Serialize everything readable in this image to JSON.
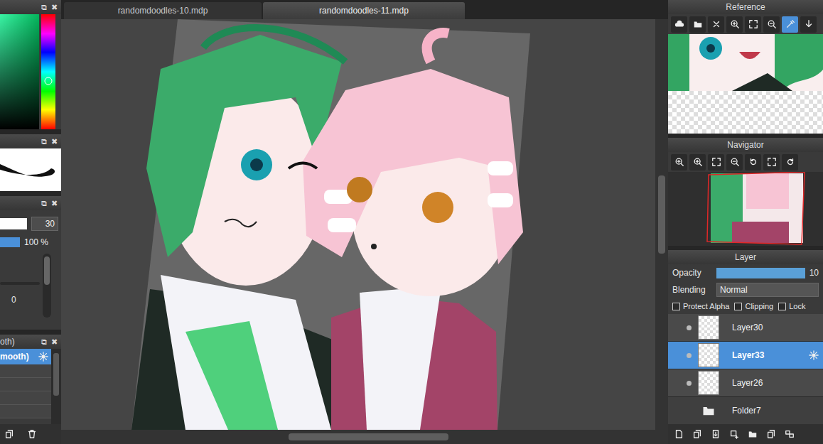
{
  "tabs": [
    {
      "label": "randomdoodles-10.mdp",
      "selected": false
    },
    {
      "label": "randomdoodles-11.mdp",
      "selected": true
    }
  ],
  "panel_buttons": {
    "float": "⧉",
    "close": "✖"
  },
  "color_panel": {
    "hue_level": 0.58
  },
  "brush_settings": {
    "size": "30",
    "opacity_reading": "100 %",
    "opacity_level": 1,
    "spacing_reading": "0"
  },
  "brush_list": {
    "header": "oth)",
    "items": [
      {
        "label": "mooth)",
        "selected": true
      }
    ]
  },
  "reference": {
    "title": "Reference",
    "tools": [
      {
        "selected": false
      },
      {
        "selected": false
      },
      {
        "selected": false
      },
      {
        "selected": false
      },
      {
        "selected": false
      },
      {
        "selected": false
      },
      {
        "selected": true
      },
      {
        "selected": false
      }
    ]
  },
  "navigator": {
    "title": "Navigator"
  },
  "layer": {
    "title": "Layer",
    "opacity_label": "Opacity",
    "opacity_reading": "10",
    "opacity_level": 1,
    "blending_label": "Blending",
    "blending": "Normal",
    "options": [
      {
        "label": "Protect Alpha",
        "checked": false
      },
      {
        "label": "Clipping",
        "checked": false
      },
      {
        "label": "Lock",
        "checked": false
      }
    ],
    "layers": [
      {
        "name": "Layer30",
        "kind": "layer",
        "visible": true,
        "selected": false
      },
      {
        "name": "Layer33",
        "kind": "layer",
        "visible": true,
        "selected": true
      },
      {
        "name": "Layer26",
        "kind": "layer",
        "visible": true,
        "selected": false
      },
      {
        "name": "Folder7",
        "kind": "folder",
        "visible": false,
        "selected": false
      }
    ]
  }
}
